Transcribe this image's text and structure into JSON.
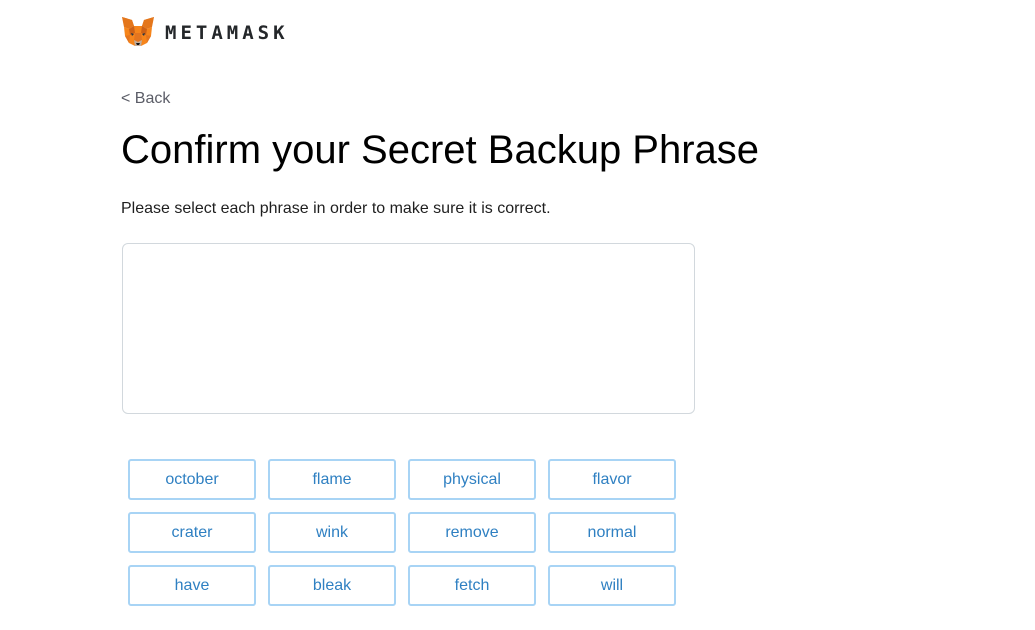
{
  "brand": {
    "wordmark": "METAMASK",
    "logo_icon": "metamask-fox-icon",
    "accent_color": "#f6851b"
  },
  "nav": {
    "back_label": "< Back"
  },
  "page": {
    "title": "Confirm your Secret Backup Phrase",
    "subtitle": "Please select each phrase in order to make sure it is correct."
  },
  "selected_words": [],
  "word_buttons": [
    "october",
    "flame",
    "physical",
    "flavor",
    "crater",
    "wink",
    "remove",
    "normal",
    "have",
    "bleak",
    "fetch",
    "will"
  ],
  "colors": {
    "word_border": "#a8d4f5",
    "word_text": "#2f80c2",
    "drop_area_border": "#d2d8dd"
  }
}
